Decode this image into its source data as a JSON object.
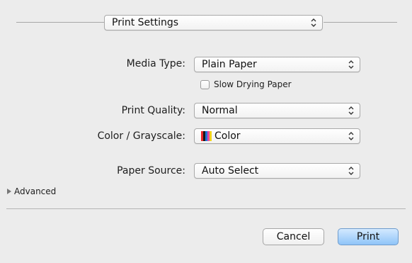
{
  "header_popup": {
    "value": "Print Settings",
    "icon": "chevron-updown-icon"
  },
  "fields": {
    "media_type": {
      "label": "Media Type:",
      "value": "Plain Paper"
    },
    "slow_drying": {
      "label": "Slow Drying Paper",
      "checked": false
    },
    "print_quality": {
      "label": "Print Quality:",
      "value": "Normal"
    },
    "color_grayscale": {
      "label": "Color / Grayscale:",
      "value": "Color",
      "swatch_colors": [
        "#e8282a",
        "#1a1a1a",
        "#1e73d8",
        "#e04aa8",
        "#f3d21b"
      ]
    },
    "paper_source": {
      "label": "Paper Source:",
      "value": "Auto Select"
    }
  },
  "advanced": {
    "label": "Advanced"
  },
  "buttons": {
    "cancel": "Cancel",
    "print": "Print"
  },
  "colors": {
    "background": "#ececec",
    "print_button": "#8fc4f8"
  }
}
